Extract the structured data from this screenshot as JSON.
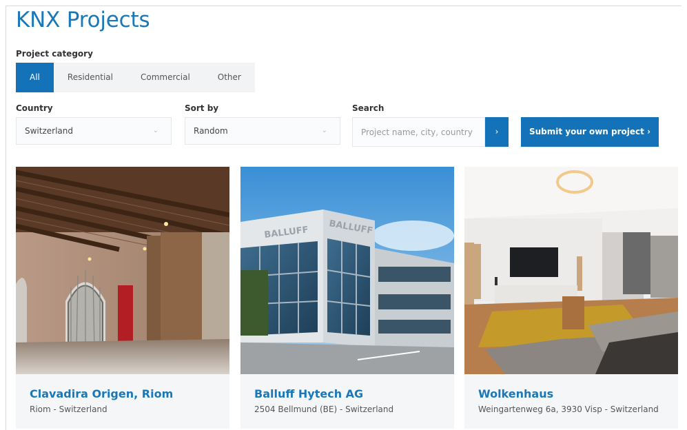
{
  "page": {
    "title": "KNX Projects"
  },
  "filters": {
    "category_label": "Project category",
    "categories": [
      "All",
      "Residential",
      "Commercial",
      "Other"
    ],
    "active_category": "All",
    "country_label": "Country",
    "country_value": "Switzerland",
    "sort_label": "Sort by",
    "sort_value": "Random",
    "search_label": "Search",
    "search_placeholder": "Project name, city, country",
    "search_button": "›",
    "submit_button": "Submit your own project ›"
  },
  "projects": [
    {
      "title": "Clavadira Origen, Riom",
      "location": "Riom - Switzerland",
      "image": "vaulted-room-photo"
    },
    {
      "title": "Balluff Hytech AG",
      "location": "2504 Bellmund (BE) - Switzerland",
      "image": "office-building-photo"
    },
    {
      "title": "Wolkenhaus",
      "location": "Weingartenweg 6a, 3930 Visp - Switzerland",
      "image": "living-room-photo"
    }
  ],
  "image_text": {
    "building_sign": "BALLUFF"
  },
  "colors": {
    "accent": "#1372b8",
    "title_blue": "#1a78b8",
    "card_bg": "#f4f6f8"
  }
}
